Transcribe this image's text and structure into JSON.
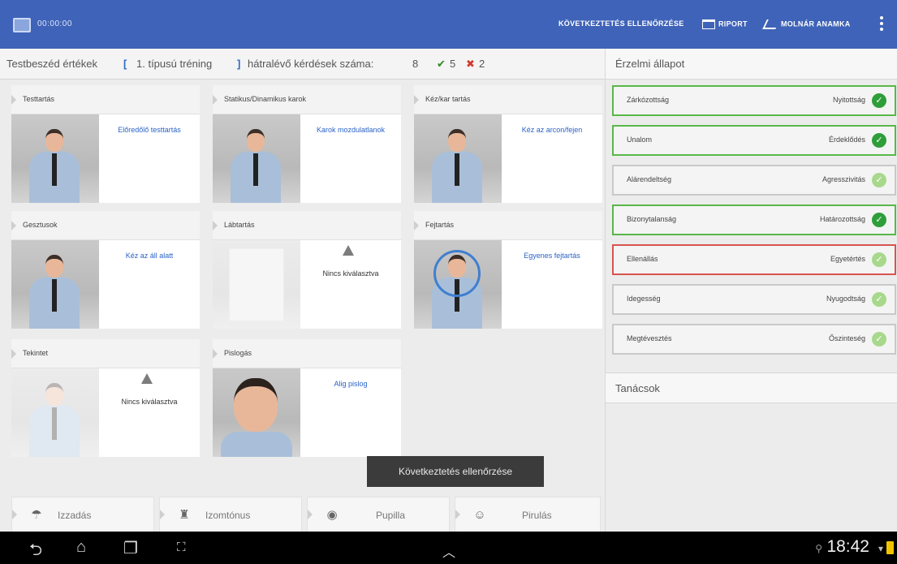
{
  "topbar": {
    "timer": "00:00:00",
    "actions": {
      "conclusion": "KÖVETKEZTETÉS ELLENŐRZÉSE",
      "report": "RIPORT",
      "connect": "MOLNÁR ANAMKA"
    }
  },
  "header": {
    "title": "Testbeszéd értékek",
    "bracket_open": "[",
    "training": "1. típusú tréning",
    "bracket_close": "]",
    "remaining_label": "hátralévő kérdések száma:",
    "remaining_count": "8",
    "correct_count": "5",
    "wrong_count": "2",
    "check_symbol": "✔",
    "cross_symbol": "✖"
  },
  "cards": [
    {
      "title": "Testtartás",
      "status": "Előredőlő testtartás"
    },
    {
      "title": "Statikus/Dinamikus karok",
      "status": "Karok mozdulatlanok"
    },
    {
      "title": "Kéz/kar tartás",
      "status": "Kéz az arcon/fejen"
    },
    {
      "title": "Gesztusok",
      "status": "Kéz az áll alatt"
    },
    {
      "title": "Lábtartás",
      "status": "Nincs kiválasztva"
    },
    {
      "title": "Fejtartás",
      "status": "Egyenes fejtartás"
    },
    {
      "title": "Tekintet",
      "status": "Nincs kiválasztva"
    },
    {
      "title": "Pislogás",
      "status": "Alig pislog"
    }
  ],
  "physiology": [
    {
      "label": "Izzadás",
      "icon": "sweat-icon"
    },
    {
      "label": "Izomtónus",
      "icon": "muscle-icon"
    },
    {
      "label": "Pupilla",
      "icon": "eye-icon"
    },
    {
      "label": "Pirulás",
      "icon": "blush-icon"
    }
  ],
  "toast": "Következtetés ellenőrzése",
  "right_panel": {
    "emotional_title": "Érzelmi állapot",
    "tips_title": "Tanácsok",
    "emotions": [
      {
        "left": "Zárkózottság",
        "right": "Nyitottság",
        "state": "selected"
      },
      {
        "left": "Unalom",
        "right": "Érdeklődés",
        "state": "selected"
      },
      {
        "left": "Alárendeltség",
        "right": "Agresszivitás",
        "state": "none"
      },
      {
        "left": "Bizonytalanság",
        "right": "Határozottság",
        "state": "selected"
      },
      {
        "left": "Ellenállás",
        "right": "Egyetértés",
        "state": "wrong"
      },
      {
        "left": "Idegesség",
        "right": "Nyugodtság",
        "state": "none"
      },
      {
        "left": "Megtévesztés",
        "right": "Őszinteség",
        "state": "none"
      }
    ]
  },
  "navbar": {
    "clock": "18:42"
  }
}
